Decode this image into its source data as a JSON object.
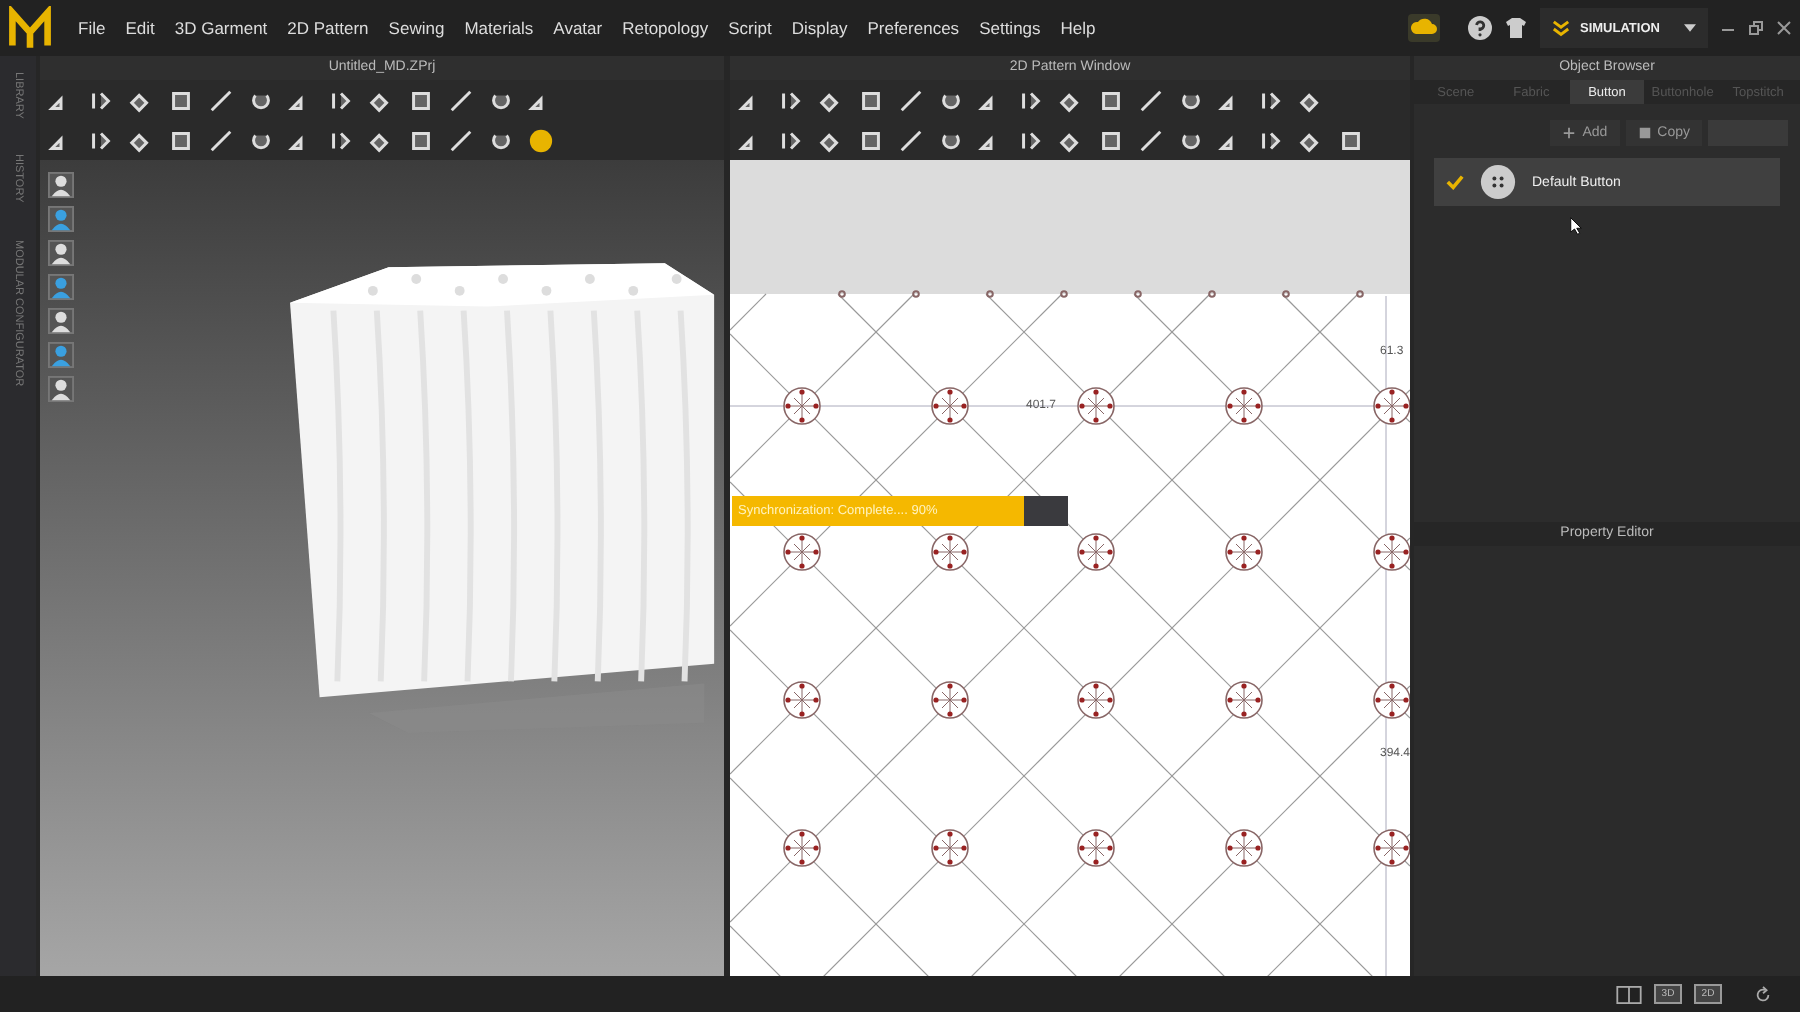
{
  "menu": {
    "items": [
      "File",
      "Edit",
      "3D Garment",
      "2D Pattern",
      "Sewing",
      "Materials",
      "Avatar",
      "Retopology",
      "Script",
      "Display",
      "Preferences",
      "Settings",
      "Help"
    ]
  },
  "mode_selector": {
    "label": "SIMULATION"
  },
  "side_strip": {
    "labels": [
      "LIBRARY",
      "HISTORY",
      "MODULAR CONFIGURATOR"
    ]
  },
  "viewport_3d": {
    "title": "Untitled_MD.ZPrj"
  },
  "pattern_window": {
    "title": "2D Pattern Window",
    "measurements": [
      "401.7",
      "61.3",
      "394.4"
    ],
    "progress": {
      "label": "Synchronization: Complete.... 90%",
      "level": 0.87
    }
  },
  "object_browser": {
    "title": "Object Browser",
    "tabs": [
      {
        "label": "Scene",
        "selected": false
      },
      {
        "label": "Fabric",
        "selected": false
      },
      {
        "label": "Button",
        "selected": true
      },
      {
        "label": "Buttonhole",
        "selected": false
      },
      {
        "label": "Topstitch",
        "selected": false
      }
    ],
    "actions": [
      {
        "label": "Add",
        "disabled": false
      },
      {
        "label": "Copy",
        "disabled": false
      }
    ],
    "items": [
      {
        "label": "Default Button",
        "checked": true,
        "selected": true
      }
    ]
  },
  "property_editor": {
    "title": "Property Editor"
  },
  "status_bar": {
    "view_buttons": [
      "3D",
      "2D"
    ]
  }
}
